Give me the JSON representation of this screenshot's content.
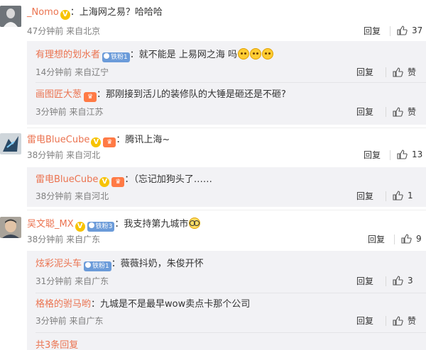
{
  "actions": {
    "reply": "回复",
    "like": "赞"
  },
  "comments": [
    {
      "user": "_Nomo",
      "sep": "：",
      "text": "上海网之易？哈哈哈",
      "time": "47分钟前",
      "loc": "来自北京",
      "likes": "37",
      "replies": [
        {
          "user": "有理想的划水者",
          "badge": "铁粉1",
          "sep": "：",
          "text": "就不能是 上易网之海 吗",
          "time": "14分钟前",
          "loc": "来自辽宁",
          "likes": "赞"
        },
        {
          "user": "画图匠大葱",
          "sep": "：",
          "text": "那刚接到活儿的装修队的大锤是砸还是不砸?",
          "time": "3分钟前",
          "loc": "来自江苏",
          "likes": "赞"
        }
      ]
    },
    {
      "user": "雷电BlueCube",
      "sep": "：",
      "text": "腾讯上海~",
      "time": "38分钟前",
      "loc": "来自河北",
      "likes": "13",
      "replies": [
        {
          "user": "雷电BlueCube",
          "sep": "：",
          "text": "（忘记加狗头了……",
          "time": "38分钟前",
          "loc": "来自河北",
          "likes": "1"
        }
      ]
    },
    {
      "user": "吴文聪_MX",
      "badge": "铁粉3",
      "sep": "：",
      "text": "我支持第九城市",
      "time": "38分钟前",
      "loc": "来自广东",
      "likes": "9",
      "replies": [
        {
          "user": "炫彩泥头车",
          "badge": "铁粉1",
          "sep": "：",
          "text": "薇薇抖奶，朱俊开怀",
          "time": "31分钟前",
          "loc": "来自广东",
          "likes": "3"
        },
        {
          "user": "格格的驸马哟",
          "sep": "：",
          "text": "九城是不是最早wow卖点卡那个公司",
          "time": "3分钟前",
          "loc": "来自广东",
          "likes": "赞"
        }
      ],
      "more": "共3条回复"
    }
  ],
  "colors": {
    "username": "#eb7350",
    "meta": "#808080",
    "reply_bg": "#f2f2f5",
    "vip": "#f7c300"
  }
}
